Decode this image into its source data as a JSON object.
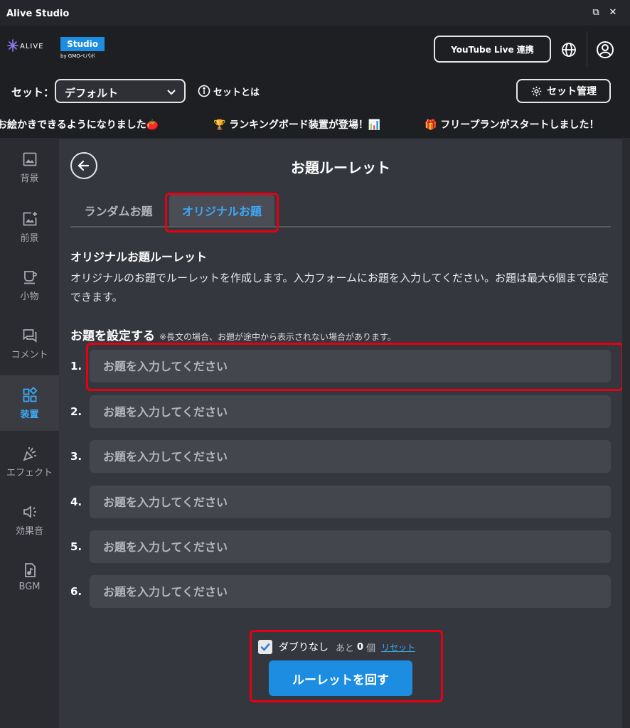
{
  "window": {
    "title": "Alive Studio",
    "restore_glyph": "⧉",
    "close_glyph": "✕"
  },
  "logo": {
    "brand": "ALIVE",
    "studio": "Studio",
    "by": "by GMOペパボ"
  },
  "header": {
    "youtube_button": "YouTube Live 連携"
  },
  "set_row": {
    "label": "セット：",
    "selected": "デフォルト",
    "info_link": "セットとは",
    "manage_button": "セット管理"
  },
  "ticker": {
    "items": [
      "お絵かきできるようになりました🍅",
      "🏆 ランキングボード装置が登場！📊",
      "🎁 フリープランがスタートしました！"
    ]
  },
  "sidebar": {
    "items": [
      {
        "label": "背景",
        "icon": "image-icon"
      },
      {
        "label": "前景",
        "icon": "image-plus-icon"
      },
      {
        "label": "小物",
        "icon": "cup-icon"
      },
      {
        "label": "コメント",
        "icon": "chat-icon"
      },
      {
        "label": "装置",
        "icon": "widgets-icon",
        "active": true
      },
      {
        "label": "エフェクト",
        "icon": "party-popper-icon"
      },
      {
        "label": "効果音",
        "icon": "speaker-icon"
      },
      {
        "label": "BGM",
        "icon": "music-file-icon"
      }
    ]
  },
  "main": {
    "title": "お題ルーレット",
    "tabs": [
      {
        "label": "ランダムお題"
      },
      {
        "label": "オリジナルお題",
        "active": true
      }
    ],
    "section_title": "オリジナルお題ルーレット",
    "description": "オリジナルのお題でルーレットを作成します。入力フォームにお題を入力してください。お題は最大6個まで設定できます。",
    "set_heading": "お題を設定する",
    "set_note": "※長文の場合、お題が途中から表示されない場合があります。",
    "questions": [
      {
        "num": "1.",
        "placeholder": "お題を入力してください",
        "value": ""
      },
      {
        "num": "2.",
        "placeholder": "お題を入力してください",
        "value": ""
      },
      {
        "num": "3.",
        "placeholder": "お題を入力してください",
        "value": ""
      },
      {
        "num": "4.",
        "placeholder": "お題を入力してください",
        "value": ""
      },
      {
        "num": "5.",
        "placeholder": "お題を入力してください",
        "value": ""
      },
      {
        "num": "6.",
        "placeholder": "お題を入力してください",
        "value": ""
      }
    ],
    "no_duplicate": {
      "label": "ダブりなし",
      "checked": true,
      "remaining_prefix": "あと",
      "remaining_count": "0",
      "remaining_unit": "個",
      "reset": "リセット"
    },
    "spin_button": "ルーレットを回す"
  },
  "colors": {
    "accent": "#1c8de0",
    "active_text": "#3da8f4",
    "highlight": "#e60012"
  }
}
